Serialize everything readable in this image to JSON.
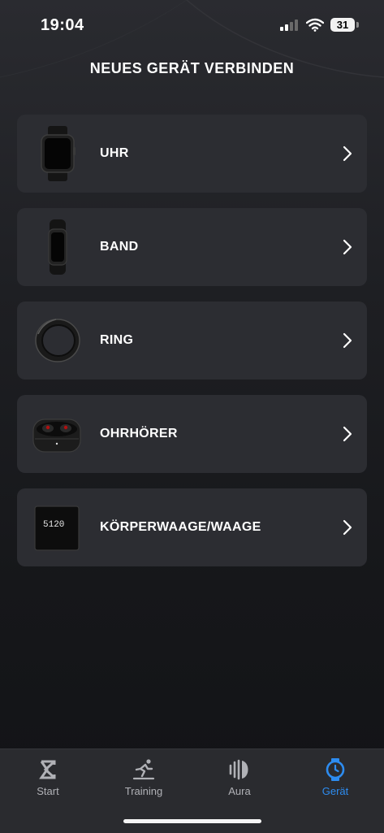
{
  "status_bar": {
    "time": "19:04",
    "battery": "31"
  },
  "title": "NEUES GERÄT VERBINDEN",
  "devices": [
    {
      "label": "UHR",
      "icon": "watch-icon"
    },
    {
      "label": "BAND",
      "icon": "band-icon"
    },
    {
      "label": "RING",
      "icon": "ring-icon"
    },
    {
      "label": "OHRHÖRER",
      "icon": "earbuds-icon"
    },
    {
      "label": "KÖRPERWAAGE/WAAGE",
      "icon": "scale-icon",
      "display": "5120"
    }
  ],
  "tabs": [
    {
      "label": "Start",
      "icon": "sigma-icon",
      "active": false
    },
    {
      "label": "Training",
      "icon": "training-icon",
      "active": false
    },
    {
      "label": "Aura",
      "icon": "aura-icon",
      "active": false
    },
    {
      "label": "Gerät",
      "icon": "device-watch-icon",
      "active": true
    }
  ],
  "colors": {
    "accent": "#2d8cf0",
    "card": "#2c2d32",
    "tab_bar": "#2a2b2f"
  }
}
